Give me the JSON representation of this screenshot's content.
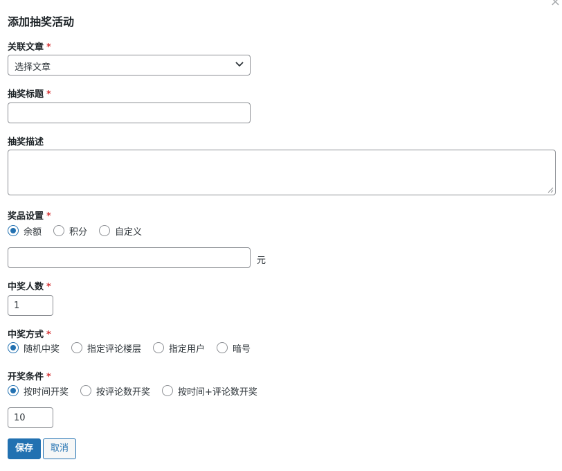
{
  "dialog": {
    "title": "添加抽奖活动",
    "close_glyph": "×"
  },
  "article": {
    "label": "关联文章",
    "required": "*",
    "selected": "选择文章"
  },
  "lottery_title": {
    "label": "抽奖标题",
    "required": "*",
    "value": ""
  },
  "lottery_desc": {
    "label": "抽奖描述",
    "value": ""
  },
  "prize": {
    "label": "奖品设置",
    "required": "*",
    "options": [
      {
        "label": "余额",
        "checked": true
      },
      {
        "label": "积分",
        "checked": false
      },
      {
        "label": "自定义",
        "checked": false
      }
    ],
    "amount_value": "",
    "unit": "元"
  },
  "winners": {
    "label": "中奖人数",
    "required": "*",
    "value": "1"
  },
  "method": {
    "label": "中奖方式",
    "required": "*",
    "options": [
      {
        "label": "随机中奖",
        "checked": true
      },
      {
        "label": "指定评论楼层",
        "checked": false
      },
      {
        "label": "指定用户",
        "checked": false
      },
      {
        "label": "暗号",
        "checked": false
      }
    ]
  },
  "condition": {
    "label": "开奖条件",
    "required": "*",
    "options": [
      {
        "label": "按时间开奖",
        "checked": true
      },
      {
        "label": "按评论数开奖",
        "checked": false
      },
      {
        "label": "按时间+评论数开奖",
        "checked": false
      }
    ],
    "count_value": "10"
  },
  "actions": {
    "save_label": "保存",
    "cancel_label": "取消"
  },
  "icons": {
    "close": "close-icon",
    "dropdown": "chevron-down-icon",
    "resize": "resize-grip-icon"
  },
  "colors": {
    "accent": "#2271b1",
    "required": "#d63638",
    "border": "#8c8f94",
    "text": "#1d2327"
  }
}
